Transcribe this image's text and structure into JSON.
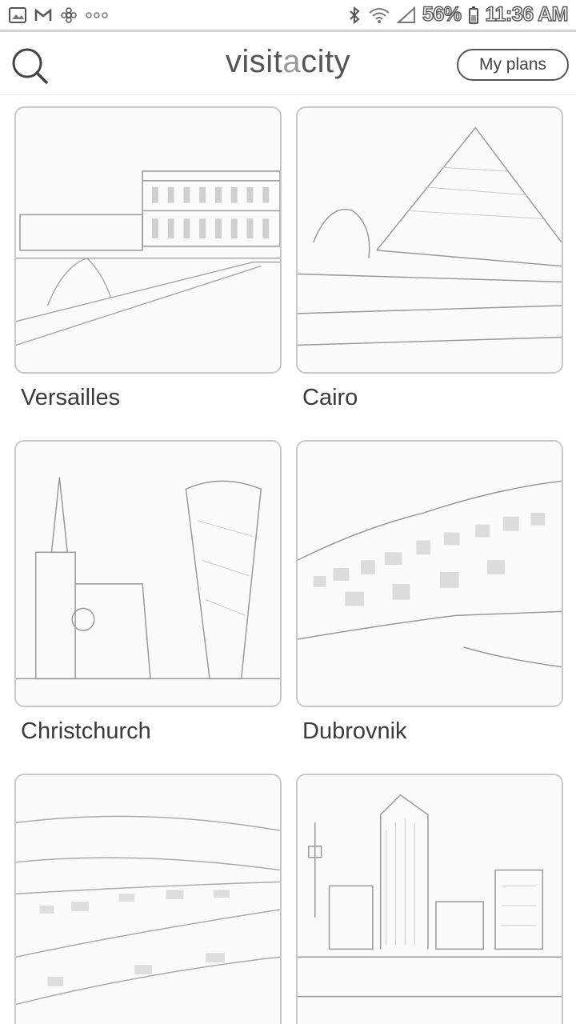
{
  "status_bar": {
    "battery": "56%",
    "time": "11:36 AM",
    "left_icons": [
      "gallery-icon",
      "gmail-icon",
      "flower-icon",
      "more-icon"
    ],
    "right_icons": [
      "bluetooth-icon",
      "wifi-icon",
      "signal-icon",
      "battery-icon"
    ]
  },
  "header": {
    "logo_prefix": "visit",
    "logo_accent": "a",
    "logo_suffix": "city",
    "my_plans_label": "My plans",
    "search_icon": "search-icon"
  },
  "cities": [
    {
      "name": "Versailles"
    },
    {
      "name": "Cairo"
    },
    {
      "name": "Christchurch"
    },
    {
      "name": "Dubrovnik"
    },
    {
      "name": ""
    },
    {
      "name": ""
    }
  ],
  "colors": {
    "background": "#ffffff",
    "text": "#3a3a3a",
    "border": "#c8c8c8"
  }
}
